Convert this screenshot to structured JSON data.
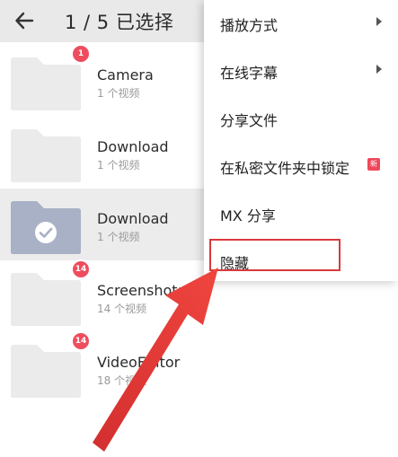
{
  "header": {
    "selection_title": "1 / 5 已选择"
  },
  "folders": [
    {
      "name": "Camera",
      "count": "1 个视频",
      "badge": "1",
      "selected": false
    },
    {
      "name": "Download",
      "count": "1 个视频",
      "badge": "",
      "selected": false
    },
    {
      "name": "Download",
      "count": "1 个视频",
      "badge": "",
      "selected": true
    },
    {
      "name": "Screenshots",
      "count": "14 个视频",
      "badge": "14",
      "selected": false
    },
    {
      "name": "VideoEditor",
      "count": "18 个视频",
      "badge": "14",
      "selected": false
    }
  ],
  "menu": {
    "items": [
      {
        "label": "播放方式",
        "has_submenu": true
      },
      {
        "label": "在线字幕",
        "has_submenu": true
      },
      {
        "label": "分享文件"
      },
      {
        "label": "在私密文件夹中锁定",
        "badge": "新"
      },
      {
        "label": "MX 分享"
      },
      {
        "label": "隐藏",
        "highlighted": true
      }
    ]
  },
  "colors": {
    "badge": "#ee4d5f",
    "folder": "#ebebeb",
    "folder_selected": "#a9b1c6",
    "annotation": "#e53935"
  },
  "icons": {
    "back": "arrow-left-icon",
    "folder": "folder-icon",
    "check": "check-circle-icon",
    "submenu": "chevron-right-icon"
  }
}
